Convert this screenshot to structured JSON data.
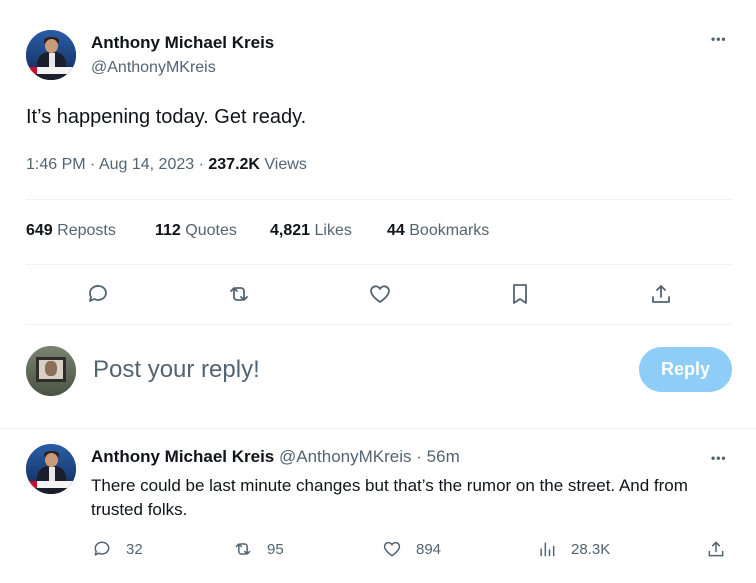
{
  "main_tweet": {
    "author_name": "Anthony Michael Kreis",
    "author_handle": "@AnthonyMKreis",
    "more_label": "•••",
    "text": "It’s happening today. Get ready.",
    "time": "1:46 PM",
    "separator": "·",
    "date": "Aug 14, 2023",
    "views_count": "237.2K",
    "views_label": "Views",
    "stats": {
      "reposts_count": "649",
      "reposts_label": "Reposts",
      "quotes_count": "112",
      "quotes_label": "Quotes",
      "likes_count": "4,821",
      "likes_label": "Likes",
      "bookmarks_count": "44",
      "bookmarks_label": "Bookmarks"
    },
    "actions": [
      "reply-icon",
      "repost-icon",
      "like-icon",
      "bookmark-icon",
      "share-icon"
    ]
  },
  "composer": {
    "placeholder": "Post your reply!",
    "reply_button_label": "Reply",
    "reply_button_color": "#8ecdf7"
  },
  "reply_tweet": {
    "author_name": "Anthony Michael Kreis",
    "author_handle": "@AnthonyMKreis",
    "separator": "·",
    "age": "56m",
    "more_label": "•••",
    "text": "There could be last minute changes but that’s the rumor on the street. And from trusted folks.",
    "replies": "32",
    "reposts": "95",
    "likes": "894",
    "views": "28.3K"
  },
  "colors": {
    "text_primary": "#0f1419",
    "text_secondary": "#536471",
    "divider": "#eff3f4"
  }
}
